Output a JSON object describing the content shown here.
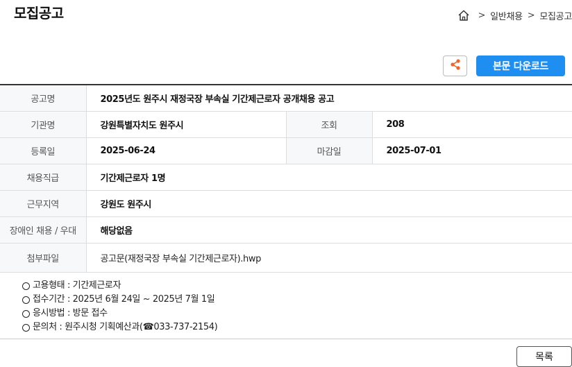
{
  "header": {
    "title": "모집공고"
  },
  "breadcrumb": {
    "home_icon": "home-icon",
    "separator": ">",
    "items": [
      "일반채용",
      "모집공고"
    ]
  },
  "toolbar": {
    "share_icon": "share-icon",
    "download_label": "본문 다운로드",
    "accent_color": "#1f8ef1"
  },
  "info": {
    "title_label": "공고명",
    "title_value": "2025년도 원주시 재정국장 부속실 기간제근로자 공개채용 공고",
    "agency_label": "기관명",
    "agency_value": "강원특별자치도 원주시",
    "views_label": "조회",
    "views_value": "208",
    "registered_label": "등록일",
    "registered_value": "2025-06-24",
    "deadline_label": "마감일",
    "deadline_value": "2025-07-01",
    "position_label": "채용직급",
    "position_value": "기간제근로자 1명",
    "region_label": "근무지역",
    "region_value": "강원도 원주시",
    "disability_label": "장애인 채용 / 우대",
    "disability_value": "해당없음",
    "attachment_label": "첨부파일",
    "attachment_value": "공고문(재정국장 부속실 기간제근로자).hwp"
  },
  "content": {
    "lines": [
      "고용형태 : 기간제근로자",
      "접수기간 : 2025년 6월 24일 ~ 2025년 7월 1일",
      "응시방법 : 방문 접수",
      "문의처 : 원주시청 기획예산과(☎033-737-2154)"
    ]
  },
  "footer": {
    "list_label": "목록"
  }
}
